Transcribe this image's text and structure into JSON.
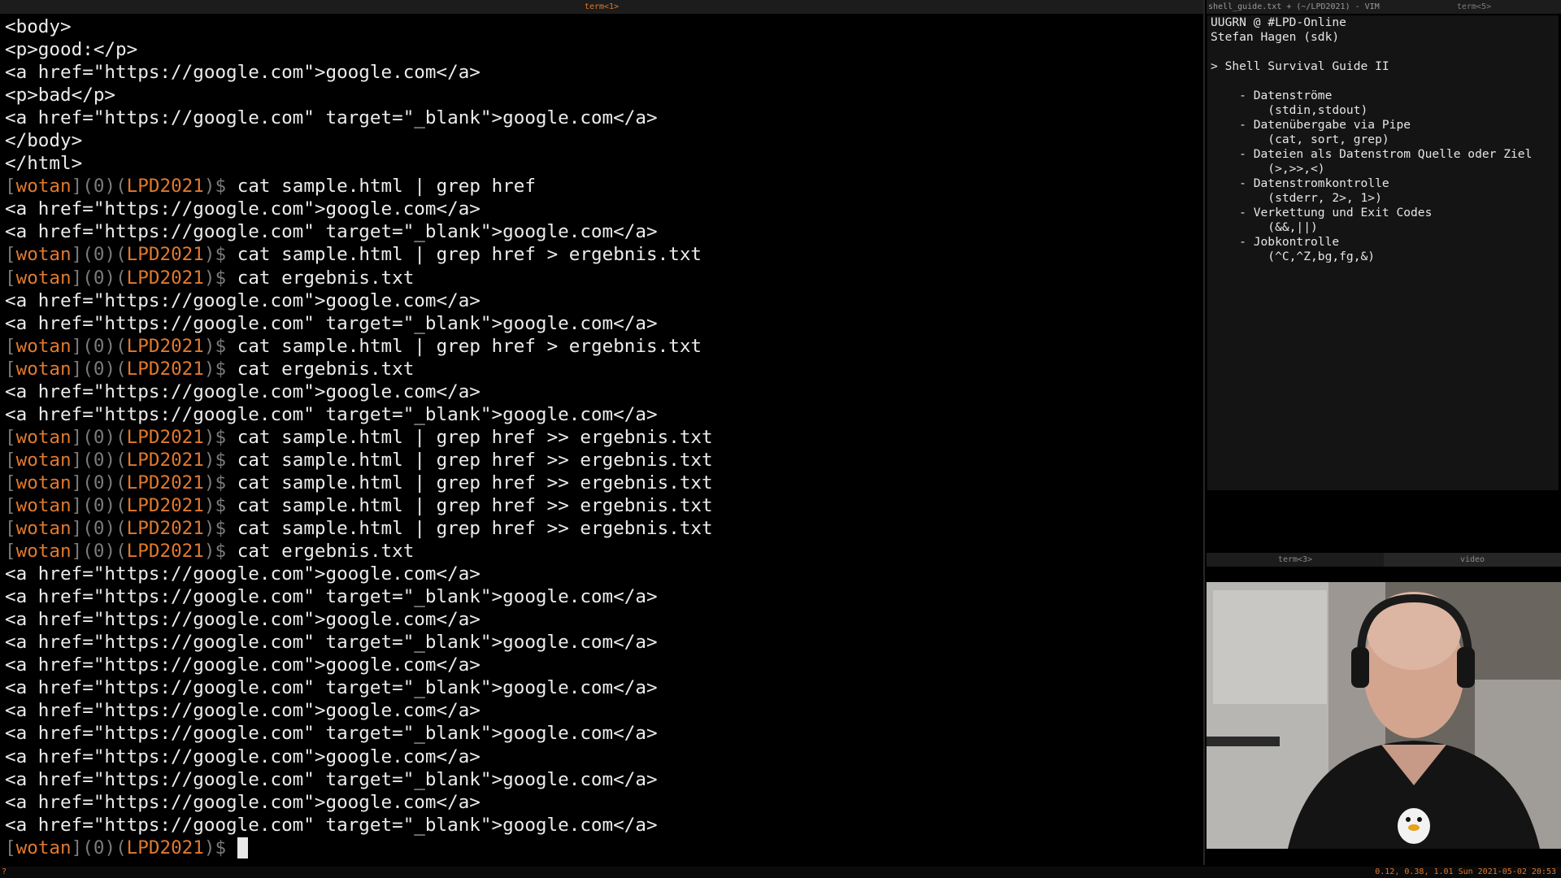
{
  "term1": {
    "title": "term<1>",
    "lines": [
      {
        "t": "text",
        "v": "<body>"
      },
      {
        "t": "text",
        "v": "<p>good:</p>"
      },
      {
        "t": "text",
        "v": "<a href=\"https://google.com\">google.com</a>"
      },
      {
        "t": "text",
        "v": "<p>bad</p>"
      },
      {
        "t": "text",
        "v": "<a href=\"https://google.com\" target=\"_blank\">google.com</a>"
      },
      {
        "t": "text",
        "v": "</body>"
      },
      {
        "t": "text",
        "v": "</html>"
      },
      {
        "t": "prompt",
        "user": "wotan",
        "status": "0",
        "host": "LPD2021",
        "cmd": "cat sample.html | grep href"
      },
      {
        "t": "text",
        "v": "<a href=\"https://google.com\">google.com</a>"
      },
      {
        "t": "text",
        "v": "<a href=\"https://google.com\" target=\"_blank\">google.com</a>"
      },
      {
        "t": "prompt",
        "user": "wotan",
        "status": "0",
        "host": "LPD2021",
        "cmd": "cat sample.html | grep href > ergebnis.txt"
      },
      {
        "t": "prompt",
        "user": "wotan",
        "status": "0",
        "host": "LPD2021",
        "cmd": "cat ergebnis.txt"
      },
      {
        "t": "text",
        "v": "<a href=\"https://google.com\">google.com</a>"
      },
      {
        "t": "text",
        "v": "<a href=\"https://google.com\" target=\"_blank\">google.com</a>"
      },
      {
        "t": "prompt",
        "user": "wotan",
        "status": "0",
        "host": "LPD2021",
        "cmd": "cat sample.html | grep href > ergebnis.txt"
      },
      {
        "t": "prompt",
        "user": "wotan",
        "status": "0",
        "host": "LPD2021",
        "cmd": "cat ergebnis.txt"
      },
      {
        "t": "text",
        "v": "<a href=\"https://google.com\">google.com</a>"
      },
      {
        "t": "text",
        "v": "<a href=\"https://google.com\" target=\"_blank\">google.com</a>"
      },
      {
        "t": "prompt",
        "user": "wotan",
        "status": "0",
        "host": "LPD2021",
        "cmd": "cat sample.html | grep href >> ergebnis.txt"
      },
      {
        "t": "prompt",
        "user": "wotan",
        "status": "0",
        "host": "LPD2021",
        "cmd": "cat sample.html | grep href >> ergebnis.txt"
      },
      {
        "t": "prompt",
        "user": "wotan",
        "status": "0",
        "host": "LPD2021",
        "cmd": "cat sample.html | grep href >> ergebnis.txt"
      },
      {
        "t": "prompt",
        "user": "wotan",
        "status": "0",
        "host": "LPD2021",
        "cmd": "cat sample.html | grep href >> ergebnis.txt"
      },
      {
        "t": "prompt",
        "user": "wotan",
        "status": "0",
        "host": "LPD2021",
        "cmd": "cat sample.html | grep href >> ergebnis.txt"
      },
      {
        "t": "prompt",
        "user": "wotan",
        "status": "0",
        "host": "LPD2021",
        "cmd": "cat ergebnis.txt"
      },
      {
        "t": "text",
        "v": "<a href=\"https://google.com\">google.com</a>"
      },
      {
        "t": "text",
        "v": "<a href=\"https://google.com\" target=\"_blank\">google.com</a>"
      },
      {
        "t": "text",
        "v": "<a href=\"https://google.com\">google.com</a>"
      },
      {
        "t": "text",
        "v": "<a href=\"https://google.com\" target=\"_blank\">google.com</a>"
      },
      {
        "t": "text",
        "v": "<a href=\"https://google.com\">google.com</a>"
      },
      {
        "t": "text",
        "v": "<a href=\"https://google.com\" target=\"_blank\">google.com</a>"
      },
      {
        "t": "text",
        "v": "<a href=\"https://google.com\">google.com</a>"
      },
      {
        "t": "text",
        "v": "<a href=\"https://google.com\" target=\"_blank\">google.com</a>"
      },
      {
        "t": "text",
        "v": "<a href=\"https://google.com\">google.com</a>"
      },
      {
        "t": "text",
        "v": "<a href=\"https://google.com\" target=\"_blank\">google.com</a>"
      },
      {
        "t": "text",
        "v": "<a href=\"https://google.com\">google.com</a>"
      },
      {
        "t": "text",
        "v": "<a href=\"https://google.com\" target=\"_blank\">google.com</a>"
      },
      {
        "t": "prompt",
        "user": "wotan",
        "status": "0",
        "host": "LPD2021",
        "cmd": "",
        "cursor": true
      }
    ]
  },
  "vim": {
    "title": "shell_guide.txt + (~/LPD2021) - VIM",
    "tab_right": "term<5>",
    "lines": [
      "UUGRN @ #LPD-Online",
      "Stefan Hagen (sdk)",
      "",
      "> Shell Survival Guide II",
      "",
      "    - Datenströme",
      "        (stdin,stdout)",
      "    - Datenübergabe via Pipe",
      "        (cat, sort, grep)",
      "    - Dateien als Datenstrom Quelle oder Ziel",
      "        (>,>>,<)",
      "    - Datenstromkontrolle",
      "        (stderr, 2>, 1>)",
      "    - Verkettung und Exit Codes",
      "        (&&,||)",
      "    - Jobkontrolle",
      "        (^C,^Z,bg,fg,&)"
    ]
  },
  "video_pane": {
    "tabs": [
      "term<3>",
      "video"
    ]
  },
  "statusbar": {
    "left": "?",
    "right": "0.12, 0.38, 1.01 Sun 2021-05-02 20:53"
  },
  "colors": {
    "accent": "#e0792e",
    "bracket": "#7b7b7b",
    "background": "#000000",
    "foreground": "#ececec"
  }
}
